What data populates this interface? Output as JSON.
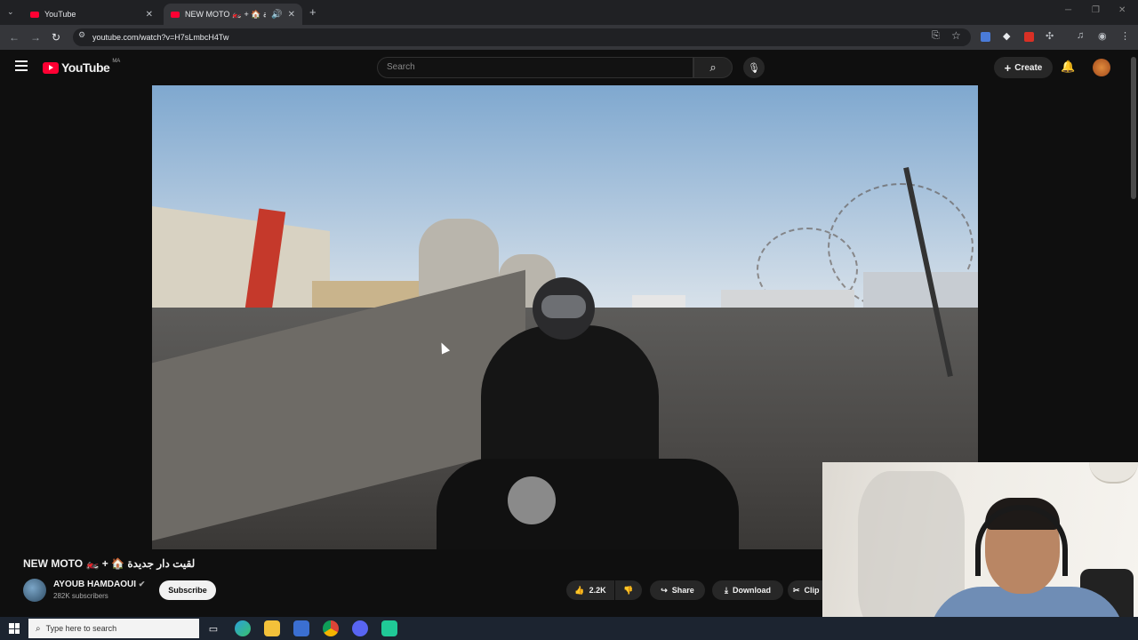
{
  "browser": {
    "tabs": [
      {
        "title": "YouTube",
        "active": false
      },
      {
        "title": "NEW MOTO 🏍️ + 🏠 لقيت دار جديدة",
        "active": true
      }
    ],
    "url": "youtube.com/watch?v=H7sLmbcH4Tw"
  },
  "youtube": {
    "logo_text": "YouTube",
    "country": "MA",
    "search_placeholder": "Search",
    "create_label": "Create"
  },
  "video": {
    "title": "NEW MOTO 🏍️ + 🏠 لقيت دار جديدة",
    "channel": "AYOUB HAMDAOUI",
    "verified": true,
    "subscribers": "282K subscribers",
    "subscribe_label": "Subscribe",
    "likes": "2.2K",
    "share_label": "Share",
    "download_label": "Download",
    "clip_label": "Clip"
  },
  "taskbar": {
    "search_placeholder": "Type here to search"
  },
  "colors": {
    "yt_red": "#ff0033",
    "background": "#0f0f0f",
    "pill": "#272727"
  }
}
